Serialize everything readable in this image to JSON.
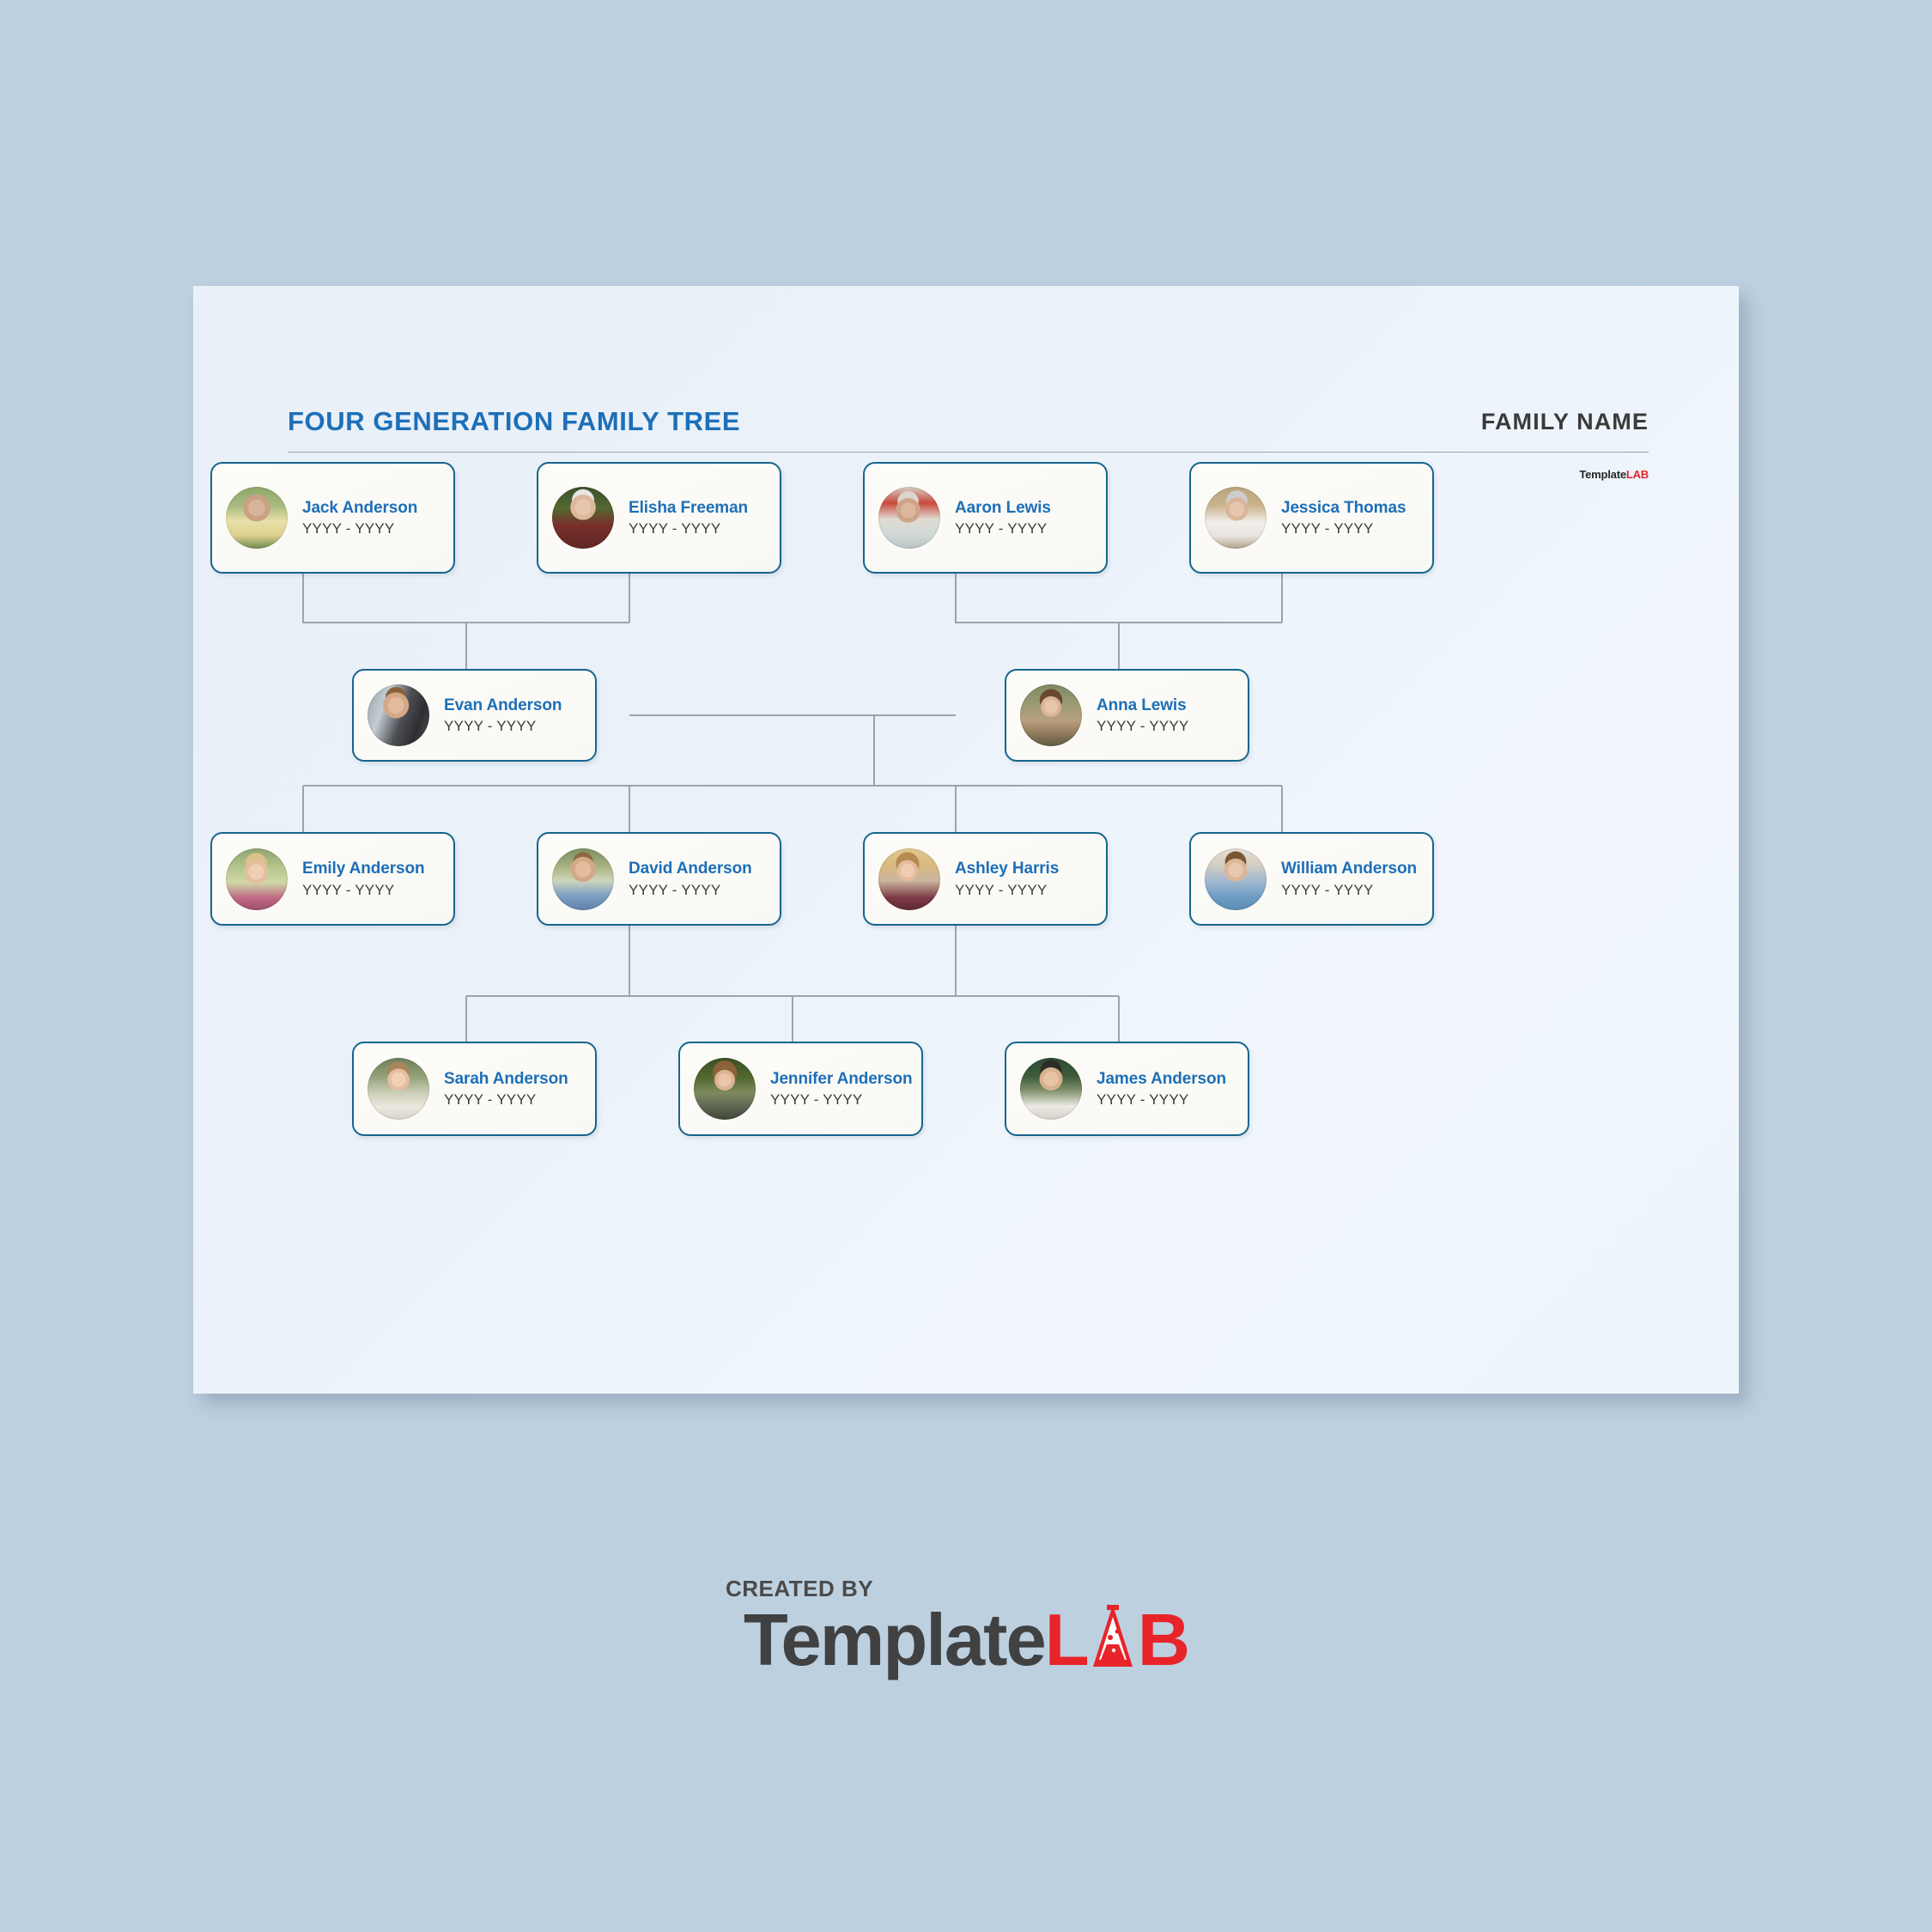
{
  "header": {
    "doc_title": "FOUR GENERATION FAMILY TREE",
    "family_name": "FAMILY NAME",
    "watermark_template": "Template",
    "watermark_lab": "LAB"
  },
  "footer": {
    "created_by": "CREATED BY",
    "logo_template": "Template",
    "logo_l": "L",
    "logo_b": "B",
    "flask_icon": "flask-icon"
  },
  "chart_data": {
    "type": "diagram",
    "diagram_kind": "family-tree",
    "generations": 4,
    "title": "FOUR GENERATION FAMILY TREE",
    "accent_color": "#1d6fb8",
    "card_border_color": "#17658f",
    "connector_color": "#9aa4ad",
    "page_background": "#eaf1f9",
    "date_placeholder": "YYYY - YYYY"
  },
  "people": [
    {
      "id": "jack",
      "name": "Jack Anderson",
      "dates": "YYYY - YYYY",
      "generation": 1,
      "avatar": "portrait-jack"
    },
    {
      "id": "elisha",
      "name": "Elisha Freeman",
      "dates": "YYYY - YYYY",
      "generation": 1,
      "avatar": "portrait-elisha"
    },
    {
      "id": "aaron",
      "name": "Aaron Lewis",
      "dates": "YYYY - YYYY",
      "generation": 1,
      "avatar": "portrait-aaron"
    },
    {
      "id": "jessica",
      "name": "Jessica Thomas",
      "dates": "YYYY - YYYY",
      "generation": 1,
      "avatar": "portrait-jessica"
    },
    {
      "id": "evan",
      "name": "Evan Anderson",
      "dates": "YYYY - YYYY",
      "generation": 2,
      "avatar": "portrait-evan"
    },
    {
      "id": "anna",
      "name": "Anna Lewis",
      "dates": "YYYY - YYYY",
      "generation": 2,
      "avatar": "portrait-anna"
    },
    {
      "id": "emily",
      "name": "Emily Anderson",
      "dates": "YYYY - YYYY",
      "generation": 3,
      "avatar": "portrait-emily"
    },
    {
      "id": "david",
      "name": "David Anderson",
      "dates": "YYYY - YYYY",
      "generation": 3,
      "avatar": "portrait-david"
    },
    {
      "id": "ashley",
      "name": "Ashley Harris",
      "dates": "YYYY - YYYY",
      "generation": 3,
      "avatar": "portrait-ashley"
    },
    {
      "id": "william",
      "name": "William Anderson",
      "dates": "YYYY - YYYY",
      "generation": 3,
      "avatar": "portrait-william"
    },
    {
      "id": "sarah",
      "name": "Sarah Anderson",
      "dates": "YYYY - YYYY",
      "generation": 4,
      "avatar": "portrait-sarah"
    },
    {
      "id": "jennifer",
      "name": "Jennifer Anderson",
      "dates": "YYYY - YYYY",
      "generation": 4,
      "avatar": "portrait-jennifer"
    },
    {
      "id": "james",
      "name": "James Anderson",
      "dates": "YYYY - YYYY",
      "generation": 4,
      "avatar": "portrait-james"
    }
  ]
}
